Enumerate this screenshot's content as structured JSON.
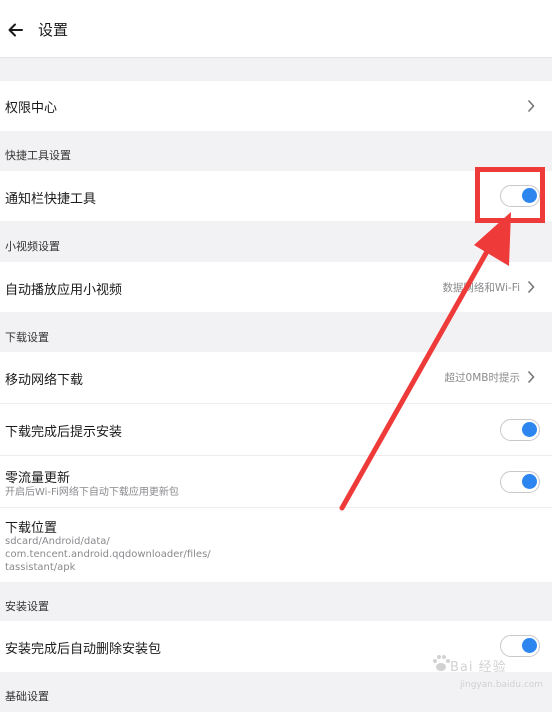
{
  "header": {
    "title": "设置"
  },
  "permission": {
    "label": "权限中心"
  },
  "quick_tools": {
    "section_title": "快捷工具设置",
    "notification_bar": {
      "label": "通知栏快捷工具",
      "enabled": true
    }
  },
  "small_video": {
    "section_title": "小视频设置",
    "autoplay": {
      "label": "自动播放应用小视频",
      "value": "数据网络和Wi-Fi"
    }
  },
  "download": {
    "section_title": "下载设置",
    "mobile_download": {
      "label": "移动网络下载",
      "value": "超过0MB时提示"
    },
    "prompt_install": {
      "label": "下载完成后提示安装",
      "enabled": true
    },
    "zero_traffic": {
      "label": "零流量更新",
      "sub": "开启后Wi-Fi网络下自动下载应用更新包",
      "enabled": true
    },
    "location": {
      "label": "下载位置",
      "path_lines": [
        "sdcard/Android/data/",
        "com.tencent.android.qqdownloader/files/",
        "tassistant/apk"
      ]
    }
  },
  "install": {
    "section_title": "安装设置",
    "auto_delete": {
      "label": "安装完成后自动删除安装包",
      "enabled": true
    }
  },
  "basic": {
    "section_title": "基础设置"
  },
  "annotation": {
    "color": "#ef3a3a"
  },
  "watermark": {
    "main": "Bai 经验",
    "sub": "jingyan.baidu.com"
  },
  "colors": {
    "toggle_on": "#2d86f0",
    "background": "#f2f2f4"
  }
}
